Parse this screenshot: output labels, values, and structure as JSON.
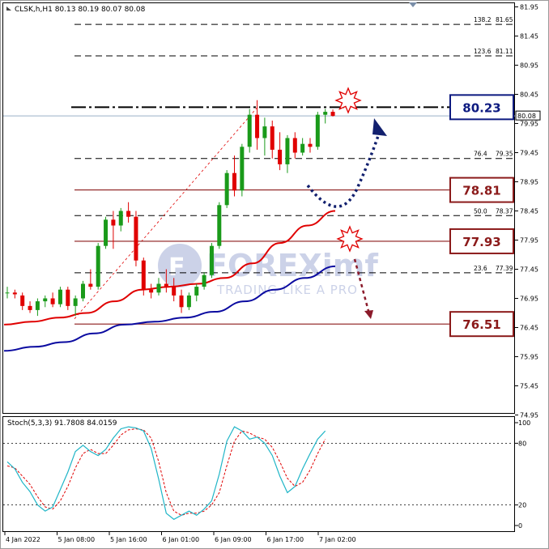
{
  "main_header": "CLSK,h,H1  80.13 80.19 80.07 80.08",
  "stoch_header": "Stoch(5,3,3) 91.7808 84.0159",
  "watermark": {
    "brand": "FOREXimf",
    "tagline": "TRADING LIKE A PRO"
  },
  "price_axis": {
    "ticks": [
      "81.95",
      "81.45",
      "80.95",
      "80.45",
      "79.95",
      "79.45",
      "78.95",
      "78.45",
      "77.95",
      "77.45",
      "76.95",
      "76.45",
      "75.95",
      "75.45",
      "74.95"
    ],
    "current_price": "80.08"
  },
  "stoch_axis": {
    "ticks": [
      "100",
      "80",
      "20",
      "0"
    ]
  },
  "time_axis": {
    "labels": [
      "4 Jan 2022",
      "5 Jan 08:00",
      "5 Jan 16:00",
      "6 Jan 01:00",
      "6 Jan 09:00",
      "6 Jan 17:00",
      "7 Jan 02:00"
    ]
  },
  "fib_levels": [
    {
      "ratio": "138.2",
      "price": "81.65"
    },
    {
      "ratio": "123.6",
      "price": "81.11"
    },
    {
      "ratio": "76.4",
      "price": "79.35"
    },
    {
      "ratio": "50.0",
      "price": "78.37"
    },
    {
      "ratio": "23.6",
      "price": "77.39"
    }
  ],
  "key_levels": [
    {
      "label": "80.23",
      "price": 80.23,
      "color": "#0d1a80",
      "style": "resistance"
    },
    {
      "label": "78.81",
      "price": 78.81,
      "color": "#8b1a1a",
      "style": "support"
    },
    {
      "label": "77.93",
      "price": 77.93,
      "color": "#8b1a1a",
      "style": "support"
    },
    {
      "label": "76.51",
      "price": 76.51,
      "color": "#8b1a1a",
      "style": "support"
    }
  ],
  "colors": {
    "bull": "#1a9a1a",
    "bear": "#e00000",
    "ma_fast": "#e00000",
    "ma_slow": "#0a0aa0",
    "stoch_main": "#1fb5c7",
    "stoch_signal": "#e00000",
    "arrow_up": "#12206e",
    "arrow_down": "#8b1a2a"
  },
  "chart_data": {
    "type": "candlestick",
    "symbol": "CLSK",
    "timeframe": "H1",
    "ylim": [
      74.85,
      82.1
    ],
    "candles": [
      [
        77.05,
        77.15,
        76.95,
        77.05
      ],
      [
        77.05,
        77.1,
        76.95,
        77.02
      ],
      [
        77.0,
        77.05,
        76.75,
        76.82
      ],
      [
        76.82,
        76.9,
        76.7,
        76.75
      ],
      [
        76.75,
        76.95,
        76.65,
        76.9
      ],
      [
        76.9,
        77.0,
        76.8,
        76.95
      ],
      [
        76.95,
        77.05,
        76.8,
        76.85
      ],
      [
        76.85,
        77.15,
        76.8,
        77.1
      ],
      [
        77.1,
        77.15,
        76.75,
        76.82
      ],
      [
        76.82,
        77.0,
        76.65,
        76.95
      ],
      [
        76.95,
        77.25,
        76.9,
        77.2
      ],
      [
        77.2,
        77.45,
        77.1,
        77.15
      ],
      [
        77.15,
        77.9,
        77.1,
        77.85
      ],
      [
        77.85,
        78.35,
        77.8,
        78.3
      ],
      [
        78.3,
        78.45,
        77.8,
        78.2
      ],
      [
        78.2,
        78.5,
        78.1,
        78.45
      ],
      [
        78.45,
        78.6,
        78.25,
        78.35
      ],
      [
        78.35,
        78.45,
        77.5,
        77.6
      ],
      [
        77.6,
        77.65,
        77.0,
        77.1
      ],
      [
        77.1,
        77.2,
        76.95,
        77.05
      ],
      [
        77.05,
        77.3,
        77.0,
        77.2
      ],
      [
        77.2,
        77.45,
        77.05,
        77.15
      ],
      [
        77.15,
        77.3,
        76.9,
        77.0
      ],
      [
        77.0,
        77.1,
        76.7,
        76.8
      ],
      [
        76.8,
        77.05,
        76.75,
        77.0
      ],
      [
        77.0,
        77.2,
        76.9,
        77.15
      ],
      [
        77.15,
        77.4,
        77.1,
        77.35
      ],
      [
        77.35,
        77.9,
        77.3,
        77.85
      ],
      [
        77.85,
        78.6,
        77.8,
        78.55
      ],
      [
        78.55,
        79.15,
        78.5,
        79.1
      ],
      [
        79.1,
        79.4,
        78.7,
        78.8
      ],
      [
        78.8,
        79.6,
        78.7,
        79.55
      ],
      [
        79.55,
        80.2,
        79.45,
        80.1
      ],
      [
        80.1,
        80.35,
        79.5,
        79.7
      ],
      [
        79.7,
        80.05,
        79.4,
        79.9
      ],
      [
        79.9,
        80.0,
        79.35,
        79.5
      ],
      [
        79.5,
        79.8,
        79.15,
        79.25
      ],
      [
        79.25,
        79.75,
        79.1,
        79.7
      ],
      [
        79.7,
        79.8,
        79.35,
        79.45
      ],
      [
        79.45,
        79.7,
        79.4,
        79.6
      ],
      [
        79.6,
        79.7,
        79.45,
        79.55
      ],
      [
        79.55,
        80.15,
        79.5,
        80.1
      ],
      [
        80.1,
        80.2,
        79.95,
        80.15
      ],
      [
        80.15,
        80.19,
        80.07,
        80.08
      ]
    ],
    "ma_fast": [
      76.5,
      76.55,
      76.62,
      76.7,
      76.9,
      77.1,
      77.15,
      77.2,
      77.3,
      77.55,
      77.9,
      78.2,
      78.45
    ],
    "ma_slow": [
      76.05,
      76.12,
      76.2,
      76.35,
      76.5,
      76.55,
      76.62,
      76.72,
      76.9,
      77.1,
      77.3,
      77.5
    ],
    "stoch_main": [
      62,
      55,
      42,
      33,
      20,
      14,
      18,
      35,
      52,
      72,
      78,
      72,
      68,
      74,
      85,
      94,
      96,
      95,
      92,
      75,
      45,
      12,
      6,
      10,
      14,
      10,
      16,
      24,
      50,
      82,
      96,
      92,
      84,
      86,
      80,
      68,
      48,
      32,
      38,
      55,
      70,
      84,
      92
    ],
    "stoch_signal": [
      58,
      56,
      48,
      40,
      28,
      18,
      16,
      24,
      38,
      56,
      70,
      74,
      70,
      70,
      78,
      88,
      93,
      94,
      93,
      85,
      62,
      32,
      14,
      10,
      12,
      12,
      14,
      20,
      32,
      58,
      82,
      92,
      90,
      86,
      84,
      76,
      62,
      46,
      38,
      42,
      54,
      70,
      84
    ]
  }
}
